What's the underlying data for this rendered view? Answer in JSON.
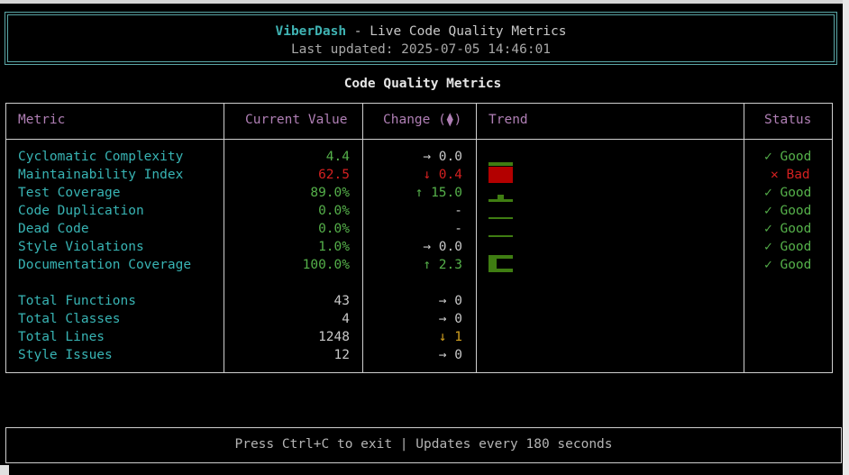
{
  "header": {
    "app_name": "ViberDash",
    "subtitle": " - Live Code Quality Metrics",
    "updated": "Last updated: 2025-07-05 14:46:01"
  },
  "table": {
    "title": "Code Quality Metrics",
    "columns": {
      "metric": "Metric",
      "current": "Current Value",
      "change": "Change (⧫)",
      "trend": "Trend",
      "status": "Status"
    },
    "rows": [
      {
        "metric": "Cyclomatic Complexity",
        "value": "4.4",
        "change": "→ 0.0",
        "status": "✓ Good"
      },
      {
        "metric": "Maintainability Index",
        "value": "62.5",
        "change": "↓ 0.4",
        "status": "✕ Bad"
      },
      {
        "metric": "Test Coverage",
        "value": "89.0%",
        "change": "↑ 15.0",
        "status": "✓ Good"
      },
      {
        "metric": "Code Duplication",
        "value": "0.0%",
        "change": "-",
        "status": "✓ Good"
      },
      {
        "metric": "Dead Code",
        "value": "0.0%",
        "change": "-",
        "status": "✓ Good"
      },
      {
        "metric": "Style Violations",
        "value": "1.0%",
        "change": "→ 0.0",
        "status": "✓ Good"
      },
      {
        "metric": "Documentation Coverage",
        "value": "100.0%",
        "change": "↑ 2.3",
        "status": "✓ Good"
      }
    ],
    "totals": [
      {
        "metric": "Total Functions",
        "value": "43",
        "change": "→ 0"
      },
      {
        "metric": "Total Classes",
        "value": "4",
        "change": "→ 0"
      },
      {
        "metric": "Total Lines",
        "value": "1248",
        "change": "↓ 1"
      },
      {
        "metric": "Style Issues",
        "value": "12",
        "change": "→ 0"
      }
    ]
  },
  "footer": {
    "text": "Press Ctrl+C to exit | Updates every 180 seconds"
  },
  "colors": {
    "accent": "#38b4b4",
    "header_purple": "#b07fb5",
    "good": "#55b04a",
    "bad": "#d32020",
    "warn": "#d1a020",
    "bad_bar": "#b30000",
    "good_bar": "#3f7d12"
  }
}
